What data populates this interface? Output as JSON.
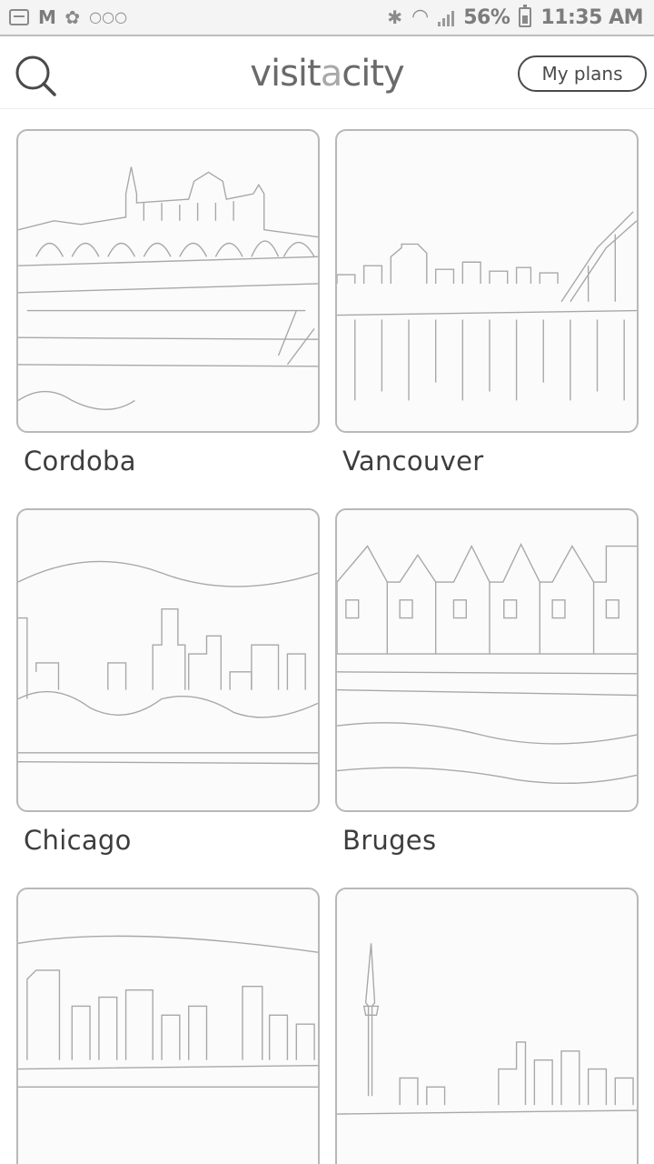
{
  "status_bar": {
    "icons_left": [
      "gallery-icon",
      "gmail-icon",
      "flower-icon",
      "more-icon"
    ],
    "battery": "56%",
    "time": "11:35 AM"
  },
  "header": {
    "logo_text_start": "visit",
    "logo_text_accent": "a",
    "logo_text_end": "city",
    "my_plans_label": "My plans"
  },
  "cities": [
    {
      "name": "Cordoba"
    },
    {
      "name": "Vancouver"
    },
    {
      "name": "Chicago"
    },
    {
      "name": "Bruges"
    },
    {
      "name": ""
    },
    {
      "name": ""
    }
  ]
}
